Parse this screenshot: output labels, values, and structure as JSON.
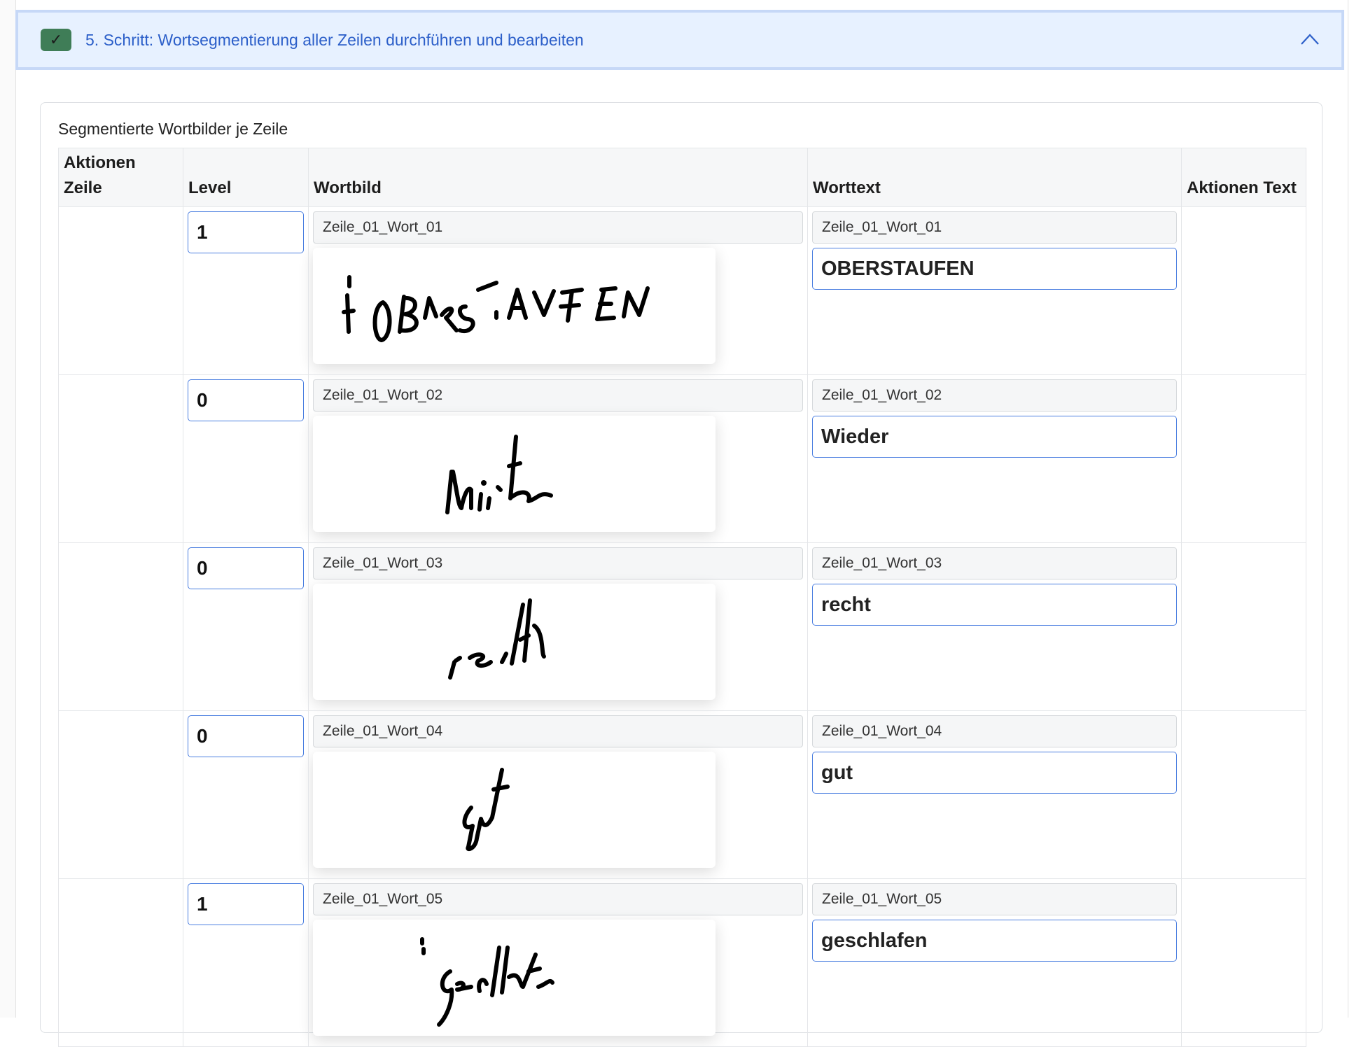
{
  "accordion": {
    "title": "5. Schritt: Wortsegmentierung aller Zeilen durchführen und bearbeiten",
    "check_symbol": "✓",
    "colors": {
      "header_bg": "#e7f1ff",
      "title": "#2c5fc9",
      "badge": "#3f7d57"
    }
  },
  "card": {
    "title": "Segmentierte Wortbilder je Zeile"
  },
  "table": {
    "headers": {
      "aktionen_zeile_1": "Aktionen",
      "aktionen_zeile_2": "Zeile",
      "level": "Level",
      "wortbild": "Wortbild",
      "worttext": "Worttext",
      "aktionen_text": "Aktionen Text"
    },
    "rows": [
      {
        "level": "1",
        "image_name": "Zeile_01_Wort_01",
        "text_name": "Zeile_01_Wort_01",
        "text": "OBERSTAUFEN"
      },
      {
        "level": "0",
        "image_name": "Zeile_01_Wort_02",
        "text_name": "Zeile_01_Wort_02",
        "text": "Wieder"
      },
      {
        "level": "0",
        "image_name": "Zeile_01_Wort_03",
        "text_name": "Zeile_01_Wort_03",
        "text": "recht"
      },
      {
        "level": "0",
        "image_name": "Zeile_01_Wort_04",
        "text_name": "Zeile_01_Wort_04",
        "text": "gut"
      },
      {
        "level": "1",
        "image_name": "Zeile_01_Wort_05",
        "text_name": "Zeile_01_Wort_05",
        "text": "geschlafen"
      }
    ]
  },
  "icons": {
    "check": "check-icon",
    "collapse": "chevron-up-icon"
  }
}
